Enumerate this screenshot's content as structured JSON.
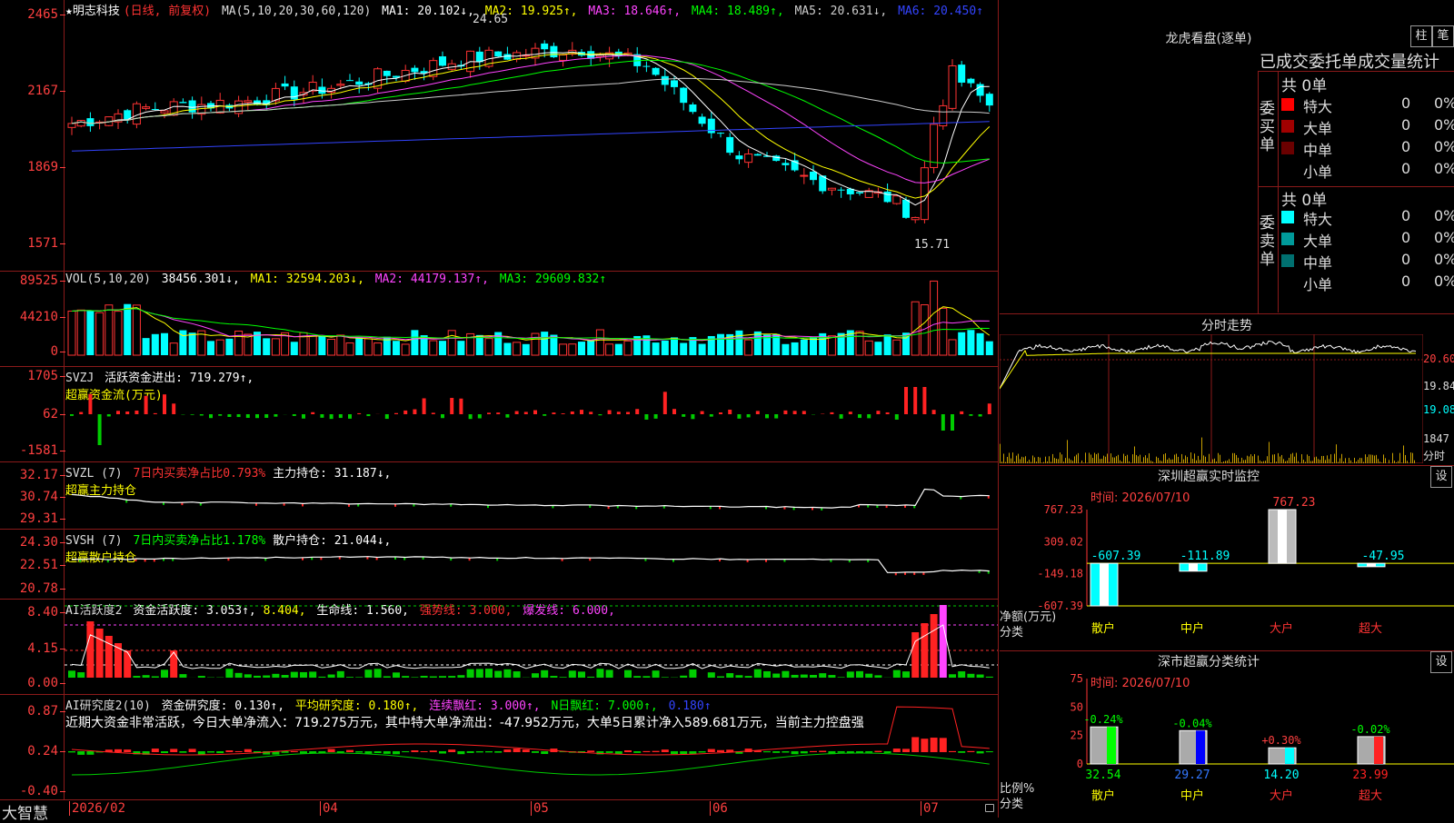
{
  "kline": {
    "name": "★明志科技",
    "mode": "(日线, 前复权)",
    "ma_params": "MA(5,10,20,30,60,120)",
    "ma": [
      {
        "label": "MA1: 20.102↓,",
        "color": "#ffffff"
      },
      {
        "label": "MA2: 19.925↑,",
        "color": "#ffff00"
      },
      {
        "label": "MA3: 18.646↑,",
        "color": "#ff44ff"
      },
      {
        "label": "MA4: 18.489↑,",
        "color": "#00ff00"
      },
      {
        "label": "MA5: 20.631↓,",
        "color": "#cccccc"
      },
      {
        "label": "MA6: 20.450↑",
        "color": "#3344ff"
      }
    ],
    "y_labels": [
      "2465",
      "2167",
      "1869",
      "1571"
    ],
    "high_label": "24.65",
    "low_label": "15.71"
  },
  "vol": {
    "header": "VOL(5,10,20)",
    "value": "38456.301↓,",
    "ma": [
      {
        "label": "MA1: 32594.203↓,",
        "color": "#ffff00"
      },
      {
        "label": "MA2: 44179.137↑,",
        "color": "#ff44ff"
      },
      {
        "label": "MA3: 29609.832↑",
        "color": "#00ff00"
      }
    ],
    "y_labels": [
      "89525",
      "44210",
      "0"
    ]
  },
  "svzj": {
    "header": "SVZJ",
    "label": "活跃资金进出: 719.279↑,",
    "sub": "超赢资金流(万元)",
    "y_labels": [
      "1705",
      "62",
      "-1581"
    ]
  },
  "svzl": {
    "header": "SVZL (7)",
    "red": "7日内买卖净占比0.793%",
    "label": "主力持仓: 31.187↓,",
    "sub": "超赢主力持仓",
    "y_labels": [
      "32.17",
      "30.74",
      "29.31"
    ]
  },
  "svsh": {
    "header": "SVSH (7)",
    "green": "7日内买卖净占比1.178%",
    "label": "散户持仓: 21.044↓,",
    "sub": "超赢散户持仓",
    "y_labels": [
      "24.30",
      "22.51",
      "20.78"
    ]
  },
  "ai2": {
    "header": "AI活跃度2",
    "label": "资金活跃度: 3.053↑,",
    "v2": "8.404,",
    "life": "生命线: 1.560,",
    "strong": "强势线: 3.000,",
    "burst": "爆发线: 6.000,",
    "y_labels": [
      "8.40",
      "4.15",
      "0.00"
    ]
  },
  "ai_res": {
    "header": "AI研究度2(10)",
    "label": "资金研究度: 0.130↑,",
    "avg": "平均研究度: 0.180↑,",
    "cont": "连续飘红: 3.000↑,",
    "n": "N日飘红: 7.000↑,",
    "last": "0.180↑",
    "note": "近期大资金非常活跃，今日大单净流入：719.275万元，其中特大单净流出：-47.952万元，大单5日累计净入589.681万元，当前主力控盘强",
    "y_labels": [
      "0.87",
      "0.24",
      "-0.40"
    ]
  },
  "xaxis": {
    "labels": [
      "2026/02",
      "04",
      "05",
      "06",
      "07"
    ]
  },
  "brand": "大智慧",
  "dragon": {
    "title": "龙虎看盘(逐单)",
    "btn1": "柱",
    "btn2": "笔",
    "subtitle": "已成交委托单成交量统计",
    "buy_label": "委买单",
    "sell_label": "委卖单",
    "buy_total": "共 0单",
    "sell_total": "共 0单",
    "buy_rows": [
      {
        "name": "特大",
        "count": "0",
        "pct": "0%",
        "color": "#ff0000"
      },
      {
        "name": "大单",
        "count": "0",
        "pct": "0%",
        "color": "#a00000"
      },
      {
        "name": "中单",
        "count": "0",
        "pct": "0%",
        "color": "#6a0000"
      },
      {
        "name": "小单",
        "count": "0",
        "pct": "0%",
        "color": "#000000"
      }
    ],
    "sell_rows": [
      {
        "name": "特大",
        "count": "0",
        "pct": "0%",
        "color": "#00ffff"
      },
      {
        "name": "大单",
        "count": "0",
        "pct": "0%",
        "color": "#009a9a"
      },
      {
        "name": "中单",
        "count": "0",
        "pct": "0%",
        "color": "#007070"
      },
      {
        "name": "小单",
        "count": "0",
        "pct": "0%",
        "color": "#000000"
      }
    ]
  },
  "intraday": {
    "title": "分时走势",
    "prices": [
      "20.60",
      "19.84",
      "19.08"
    ],
    "vol_top": "1847",
    "vol_bottom": "分时"
  },
  "sz_monitor": {
    "title": "深圳超赢实时监控",
    "btn": "设",
    "time": "时间: 2026/07/10",
    "y_labels": [
      "767.23",
      "309.02",
      "-149.18",
      "-607.39"
    ],
    "axis_label": "净额(万元)",
    "axis_label2": "分类",
    "bars": [
      {
        "cat": "散户",
        "value": "-607.39",
        "num": -607.39
      },
      {
        "cat": "中户",
        "value": "-111.89",
        "num": -111.89
      },
      {
        "cat": "大户",
        "value": "767.23",
        "num": 767.23
      },
      {
        "cat": "超大",
        "value": "-47.95",
        "num": -47.95
      }
    ]
  },
  "sz_class": {
    "title": "深市超赢分类统计",
    "btn": "设",
    "time": "时间: 2026/07/10",
    "y_labels": [
      "75",
      "50",
      "25",
      "0"
    ],
    "axis_label": "比例%",
    "axis_label2": "分类",
    "bars": [
      {
        "cat": "散户",
        "value": "32.54",
        "change": "-0.24%",
        "num": 32.54,
        "color": "#00ff00"
      },
      {
        "cat": "中户",
        "value": "29.27",
        "change": "-0.04%",
        "num": 29.27,
        "color": "#0000ff"
      },
      {
        "cat": "大户",
        "value": "14.20",
        "change": "+0.30%",
        "num": 14.2,
        "color": "#00ffff"
      },
      {
        "cat": "超大",
        "value": "23.99",
        "change": "-0.02%",
        "num": 23.99,
        "color": "#ff2222"
      }
    ]
  }
}
